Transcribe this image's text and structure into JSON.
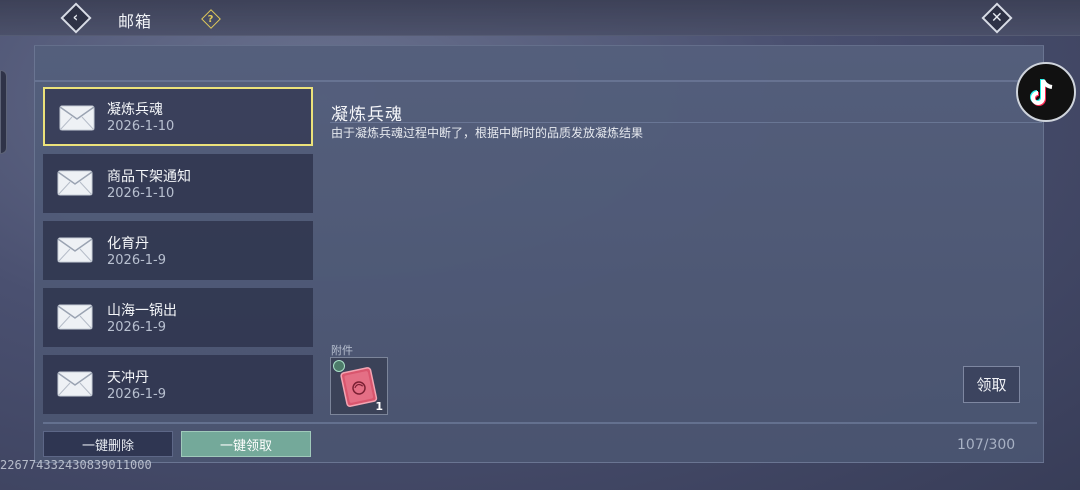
{
  "header": {
    "title": "邮箱",
    "back_icon": "chevron-left-icon",
    "help_label": "?",
    "close_icon": "close-icon"
  },
  "mail_list": [
    {
      "title": "凝炼兵魂",
      "date": "2026-1-10",
      "selected": true
    },
    {
      "title": "商品下架通知",
      "date": "2026-1-10",
      "selected": false
    },
    {
      "title": "化育丹",
      "date": "2026-1-9",
      "selected": false
    },
    {
      "title": "山海一锅出",
      "date": "2026-1-9",
      "selected": false
    },
    {
      "title": "天冲丹",
      "date": "2026-1-9",
      "selected": false
    }
  ],
  "detail": {
    "title": "凝炼兵魂",
    "body": "由于凝炼兵魂过程中断了，根据中断时的品质发放凝炼结果",
    "attachment_label": "附件",
    "attachment_count": "1",
    "claim_label": "领取"
  },
  "footer": {
    "delete_all_label": "一键删除",
    "claim_all_label": "一键领取",
    "mail_count": "107/300"
  },
  "player_id": "226774332430839011000",
  "colors": {
    "selected_border": "#ece27a",
    "claim_all_bg": "#74a99a",
    "help_accent": "#e0c95a"
  }
}
